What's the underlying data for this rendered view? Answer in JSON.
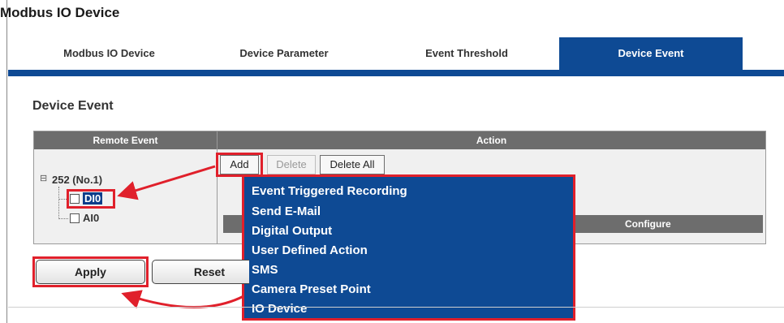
{
  "page": {
    "title": "Modbus IO Device"
  },
  "tabs": [
    {
      "label": "Modbus IO Device"
    },
    {
      "label": "Device Parameter"
    },
    {
      "label": "Event Threshold"
    },
    {
      "label": "Device Event"
    }
  ],
  "section": {
    "title": "Device Event"
  },
  "table": {
    "col_remote_event": "Remote Event",
    "col_action": "Action",
    "col_configure": "Configure"
  },
  "tree": {
    "root": {
      "toggle": "⊟",
      "label": "252 (No.1)"
    },
    "children": [
      {
        "label": "DI0",
        "selected": true
      },
      {
        "label": "AI0",
        "selected": false
      }
    ]
  },
  "action_buttons": {
    "add": "Add",
    "delete": "Delete",
    "delete_all": "Delete All"
  },
  "action_menu": {
    "items": [
      "Event Triggered Recording",
      "Send E-Mail",
      "Digital Output",
      "User Defined Action",
      "SMS",
      "Camera Preset Point",
      "IO Device"
    ]
  },
  "form_buttons": {
    "apply": "Apply",
    "reset": "Reset"
  },
  "colors": {
    "accent": "#0e4a94",
    "highlight": "#e0202b",
    "header_gray": "#6d6d6d"
  }
}
